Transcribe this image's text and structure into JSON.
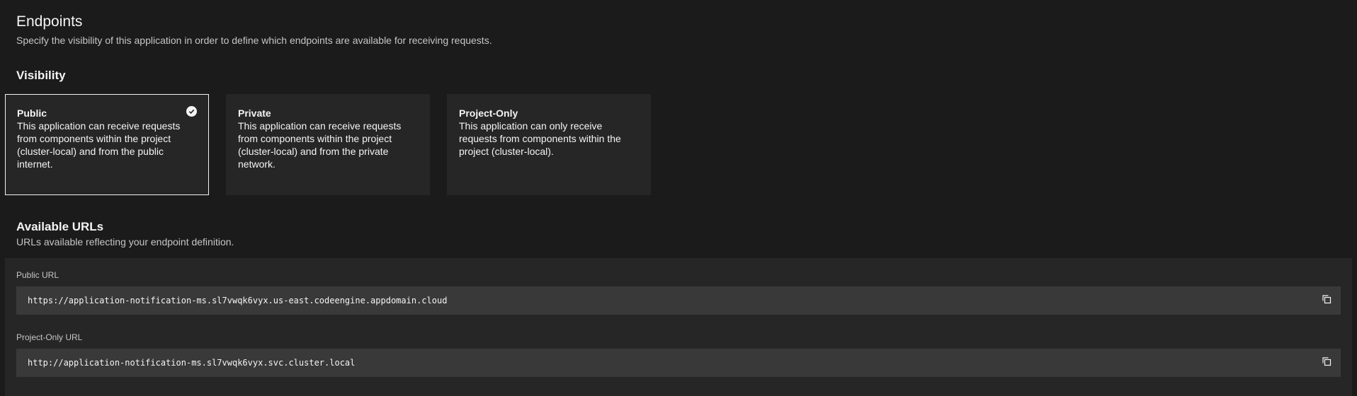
{
  "endpoints": {
    "title": "Endpoints",
    "description": "Specify the visibility of this application in order to define which endpoints are available for receiving requests."
  },
  "visibility": {
    "title": "Visibility",
    "selected": "Public",
    "options": [
      {
        "title": "Public",
        "description": "This application can receive requests from components within the project (cluster-local) and from the public internet."
      },
      {
        "title": "Private",
        "description": "This application can receive requests from components within the project (cluster-local) and from the private network."
      },
      {
        "title": "Project-Only",
        "description": "This application can only receive requests from components within the project (cluster-local)."
      }
    ]
  },
  "available_urls": {
    "title": "Available URLs",
    "description": "URLs available reflecting your endpoint definition.",
    "urls": [
      {
        "label": "Public URL",
        "value": "https://application-notification-ms.sl7vwqk6vyx.us-east.codeengine.appdomain.cloud",
        "icon": "copy-icon"
      },
      {
        "label": "Project-Only URL",
        "value": "http://application-notification-ms.sl7vwqk6vyx.svc.cluster.local",
        "icon": "copy-icon"
      }
    ]
  },
  "colors": {
    "background": "#1b1b1b",
    "tile": "#262626",
    "field": "#393939",
    "text": "#f4f4f4",
    "muted": "#c6c6c6"
  }
}
